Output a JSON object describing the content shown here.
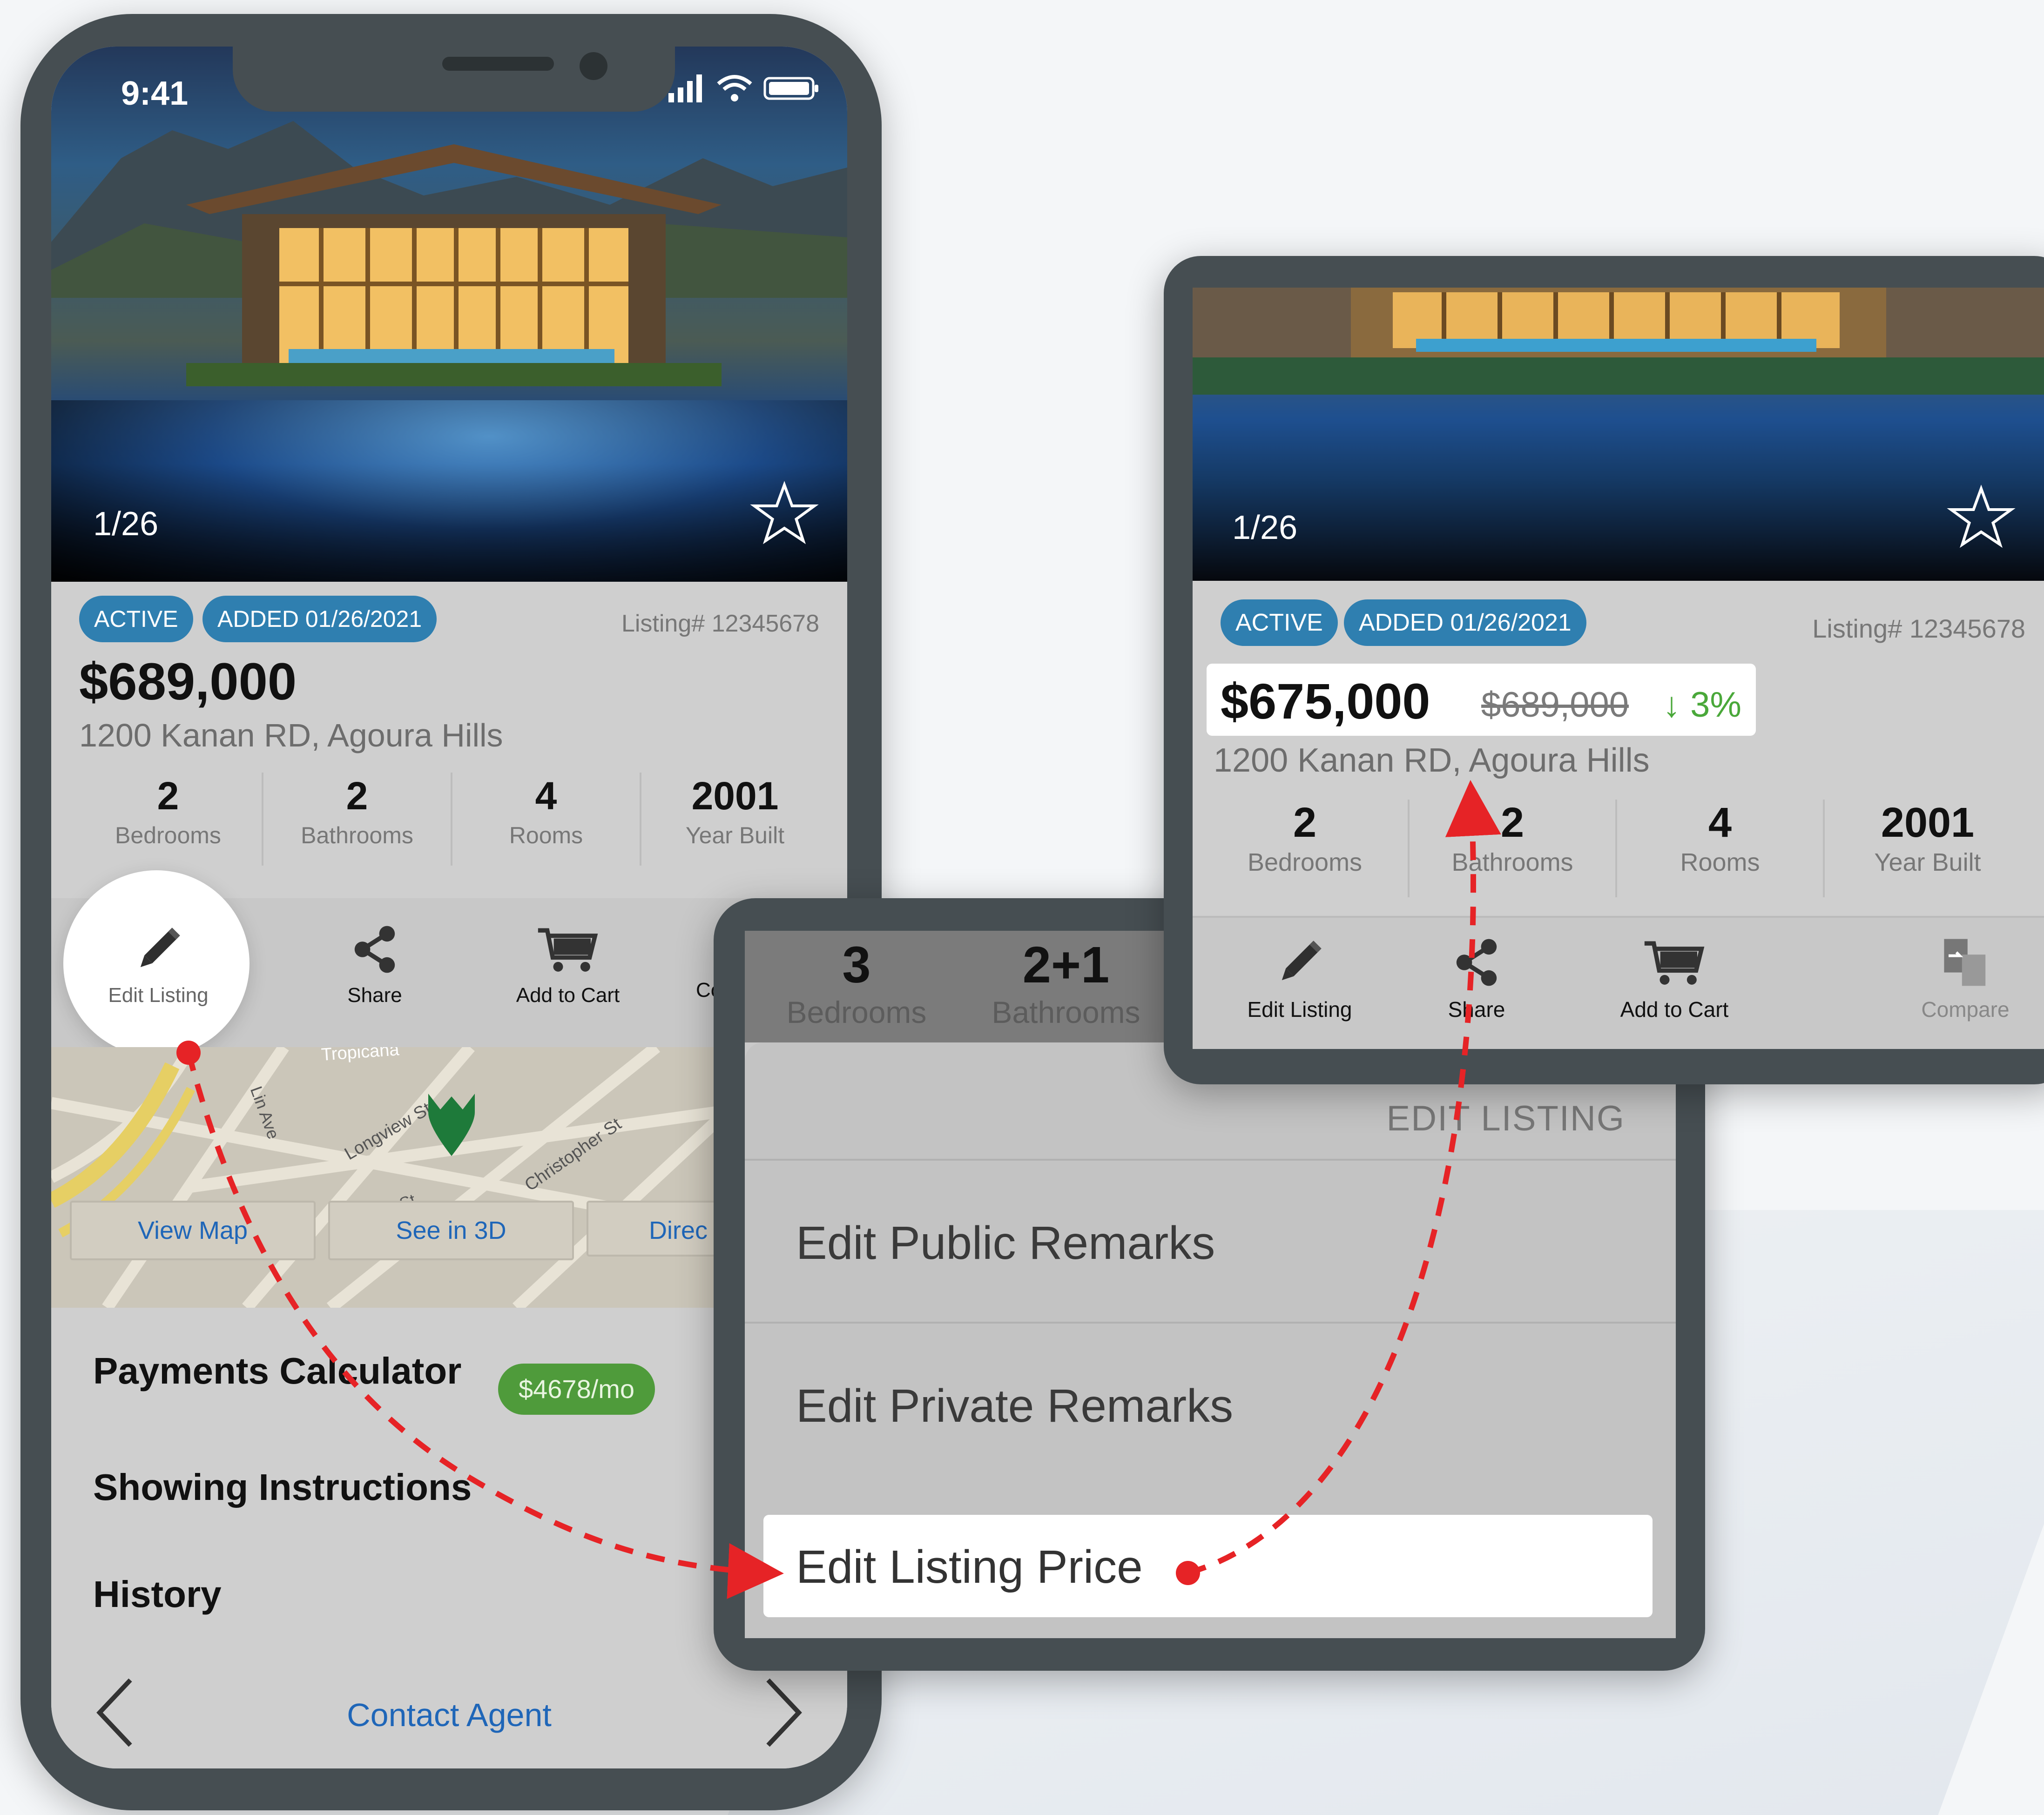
{
  "status_bar": {
    "time": "9:41"
  },
  "listing": {
    "photo_counter": "1/26",
    "badges": [
      "ACTIVE",
      "ADDED 01/26/2021"
    ],
    "listing_number": "Listing# 12345678",
    "price": "$689,000",
    "address": "1200 Kanan RD, Agoura Hills",
    "stats": [
      {
        "value": "2",
        "label": "Bedrooms"
      },
      {
        "value": "2",
        "label": "Bathrooms"
      },
      {
        "value": "4",
        "label": "Rooms"
      },
      {
        "value": "2001",
        "label": "Year Built"
      }
    ],
    "actions": [
      "Edit Listing",
      "Share",
      "Add to Cart",
      "Co"
    ],
    "map_labels": {
      "street_1": "Tropicana",
      "street_2": "Longview St",
      "street_3": "Christopher St",
      "street_4": "Lin Ave",
      "street_5": "rty St"
    },
    "map_buttons": [
      "View Map",
      "See in 3D",
      "Direc"
    ],
    "sections": [
      "Payments Calculator",
      "Showing Instructions",
      "History"
    ],
    "payment_badge": "$4678/mo",
    "contact": "Contact Agent"
  },
  "popup": {
    "stats": [
      {
        "value": "3",
        "label": "Bedrooms"
      },
      {
        "value": "2+1",
        "label": "Bathrooms"
      }
    ],
    "title": "EDIT LISTING",
    "items": [
      "Edit Public Remarks",
      "Edit Private Remarks",
      "Edit Listing Price"
    ]
  },
  "updated": {
    "photo_counter": "1/26",
    "badges": [
      "ACTIVE",
      "ADDED 01/26/2021"
    ],
    "listing_number": "Listing# 12345678",
    "new_price": "$675,000",
    "old_price": "$689,000",
    "price_drop": "↓ 3%",
    "address": "1200 Kanan RD, Agoura Hills",
    "stats": [
      {
        "value": "2",
        "label": "Bedrooms"
      },
      {
        "value": "2",
        "label": "Bathrooms"
      },
      {
        "value": "4",
        "label": "Rooms"
      },
      {
        "value": "2001",
        "label": "Year Built"
      }
    ],
    "actions": [
      "Edit Listing",
      "Share",
      "Add to Cart",
      "Compare"
    ]
  },
  "colors": {
    "badge_blue": "#2f7fb0",
    "link_blue": "#1f66b8",
    "annotation_red": "#e62326",
    "payment_green": "#4f9b3b",
    "drop_green": "#4aa83a",
    "device_frame": "#464e52"
  },
  "icons": [
    "signal-icon",
    "wifi-icon",
    "battery-icon",
    "star-icon",
    "pencil-icon",
    "share-icon",
    "cart-icon",
    "compare-icon",
    "location-pin-icon",
    "chevron-left-icon",
    "chevron-right-icon"
  ]
}
